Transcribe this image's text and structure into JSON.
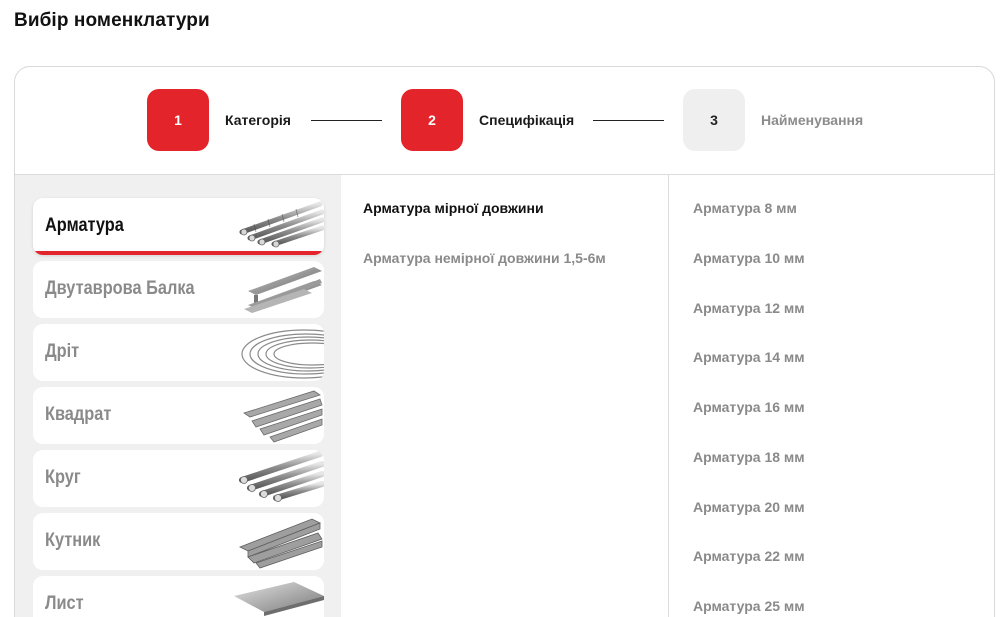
{
  "page": {
    "title": "Вибір номенклатури"
  },
  "stepper": {
    "steps": [
      {
        "num": "1",
        "label": "Категорія"
      },
      {
        "num": "2",
        "label": "Специфікація"
      },
      {
        "num": "3",
        "label": "Найменування"
      }
    ]
  },
  "categories": [
    {
      "label": "Арматура",
      "icon": "rebar-image"
    },
    {
      "label": "Двутаврова Балка",
      "icon": "ibeam-image"
    },
    {
      "label": "Дріт",
      "icon": "wire-coil-image"
    },
    {
      "label": "Квадрат",
      "icon": "square-bar-image"
    },
    {
      "label": "Круг",
      "icon": "round-bar-image"
    },
    {
      "label": "Кутник",
      "icon": "angle-bar-image"
    },
    {
      "label": "Лист",
      "icon": "sheet-image"
    }
  ],
  "specifications": [
    {
      "label": "Арматура мірної довжини"
    },
    {
      "label": "Арматура немірної довжини 1,5-6м"
    }
  ],
  "names": [
    {
      "label": "Арматура 8 мм"
    },
    {
      "label": "Арматура 10 мм"
    },
    {
      "label": "Арматура 12 мм"
    },
    {
      "label": "Арматура 14 мм"
    },
    {
      "label": "Арматура 16 мм"
    },
    {
      "label": "Арматура 18 мм"
    },
    {
      "label": "Арматура 20 мм"
    },
    {
      "label": "Арматура 22 мм"
    },
    {
      "label": "Арматура 25 мм"
    }
  ],
  "colors": {
    "accent": "#e3242b",
    "inactive_text": "#8a8a8a",
    "panel_bg": "#f0f0f0"
  }
}
